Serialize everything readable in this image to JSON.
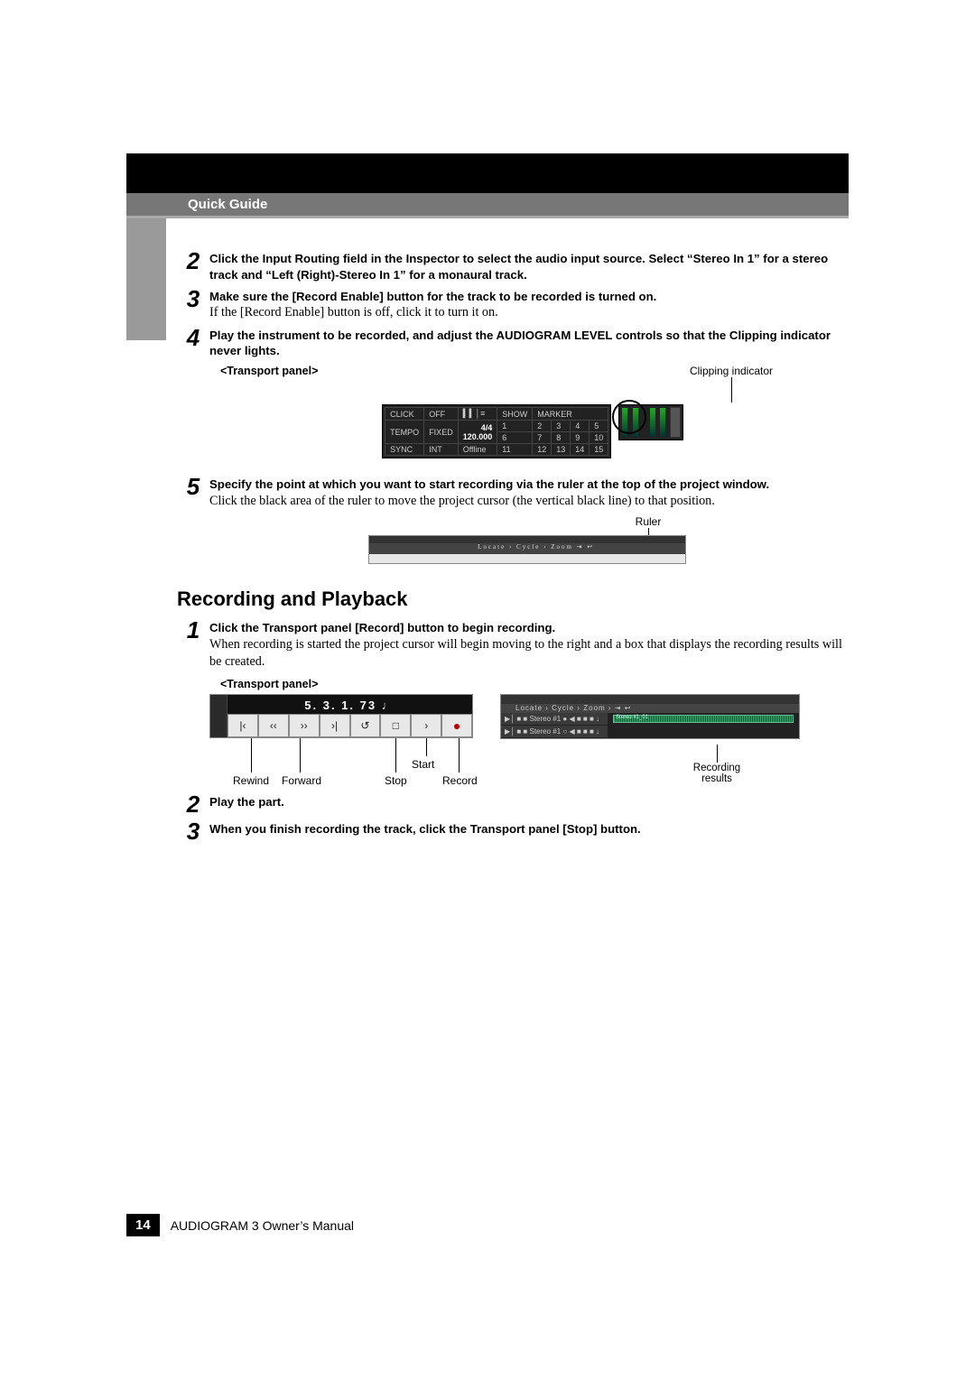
{
  "header": {
    "title": "Quick Guide"
  },
  "steps_top": {
    "s2": {
      "num": "2",
      "text": "Click the Input Routing field in the Inspector to select the audio input source. Select “Stereo In 1” for a stereo track and “Left (Right)-Stereo In 1” for a monaural track."
    },
    "s3": {
      "num": "3",
      "bold": "Make sure the [Record Enable] button for the track to be recorded is turned on.",
      "plain": "If the [Record Enable] button is off, click it to turn it on."
    },
    "s4": {
      "num": "4",
      "text": "Play the instrument to be recorded, and adjust the AUDIOGRAM LEVEL controls so that the Clipping indicator never lights."
    },
    "transport_label": "<Transport panel>",
    "clipping_label": "Clipping indicator",
    "panel1": {
      "row1": [
        "CLICK",
        "OFF",
        "▍▍│≡",
        "SHOW",
        "MARKER"
      ],
      "row2": [
        "TEMPO",
        "FIXED",
        "4/4\n120.000",
        "1",
        "2",
        "3",
        "4",
        "5"
      ],
      "row2b": [
        "6",
        "7",
        "8",
        "9",
        "10"
      ],
      "row3": [
        "SYNC",
        "INT",
        "Offline",
        "11",
        "12",
        "13",
        "14",
        "15"
      ]
    },
    "s5": {
      "num": "5",
      "bold": "Specify the point at which you want to start recording via the ruler at the top of the project window.",
      "plain": "Click the black area of the ruler to move the project cursor (the vertical black line) to that position."
    },
    "ruler_label": "Ruler",
    "ruler_toolbar": "Locate   › Cycle   › Zoom    ⇥  ↩"
  },
  "section": {
    "title": "Recording and Playback"
  },
  "steps_bottom": {
    "s1": {
      "num": "1",
      "bold": "Click the Transport panel [Record] button to begin recording.",
      "plain": "When recording is started the project cursor will begin moving to the right and a box that displays the recording results will be created."
    },
    "transport_label": "<Transport panel>",
    "panel2": {
      "time": "5.  3.  1.   73 ♩",
      "buttons": {
        "rewind_start": "|‹",
        "rewind": "‹‹",
        "forward": "››",
        "forward_end": "›|",
        "loop": "↺",
        "stop": "□",
        "start": "›",
        "record": "●"
      },
      "labels": {
        "rewind": "Rewind",
        "forward": "Forward",
        "stop": "Stop",
        "start": "Start",
        "record": "Record"
      }
    },
    "results_panel": {
      "toolbar": "Locate   › Cycle   › Zoom   ›  ⇥  ↩",
      "track1": "▶│ ■  ■  Stereo #1    ● ◀ ■ ■ ■ ↓",
      "track2": "▶│ ■  ■  Stereo #1    ○ ◀ ■ ■ ■ ↓",
      "clip": "Stereo #1_01",
      "callout": "Recording\nresults"
    },
    "s2": {
      "num": "2",
      "text": "Play the part."
    },
    "s3": {
      "num": "3",
      "text": "When you finish recording the track, click the Transport panel [Stop] button."
    }
  },
  "footer": {
    "page": "14",
    "manual": "AUDIOGRAM 3 Owner’s Manual"
  }
}
